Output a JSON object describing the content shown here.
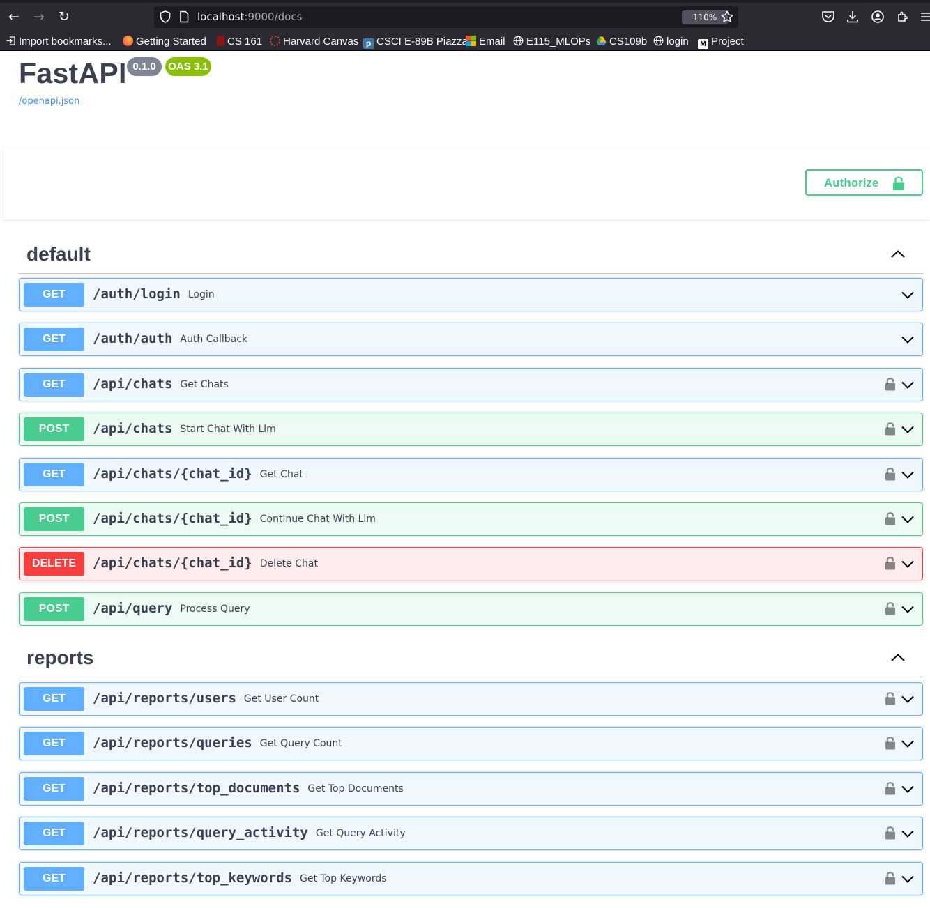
{
  "browser": {
    "url_host": "localhost",
    "url_path": ":9000/docs",
    "zoom": "110%",
    "bookmarks": [
      {
        "label": "Import bookmarks...",
        "icon": "import-icon"
      },
      {
        "label": "Getting Started",
        "icon": "firefox-icon"
      },
      {
        "label": "CS 161",
        "icon": "stanford-icon"
      },
      {
        "label": "Harvard Canvas",
        "icon": "canvas-icon"
      },
      {
        "label": "CSCI E-89B Piazza",
        "icon": "piazza-icon"
      },
      {
        "label": "Email",
        "icon": "microsoft-icon"
      },
      {
        "label": "E115_MLOPs",
        "icon": "globe-icon"
      },
      {
        "label": "CS109b",
        "icon": "drive-icon"
      },
      {
        "label": "login",
        "icon": "globe-icon"
      },
      {
        "label": "Project",
        "icon": "medium-icon"
      }
    ]
  },
  "info": {
    "title": "FastAPI",
    "version": "0.1.0",
    "oas": "OAS 3.1",
    "spec_link": "/openapi.json"
  },
  "auth": {
    "label": "Authorize"
  },
  "colors": {
    "get": "#61affe",
    "post": "#49cc90",
    "delete": "#f93e3e"
  },
  "tags": [
    {
      "name": "default",
      "operations": [
        {
          "method": "GET",
          "path": "/auth/login",
          "summary": "Login",
          "locked": false
        },
        {
          "method": "GET",
          "path": "/auth/auth",
          "summary": "Auth Callback",
          "locked": false
        },
        {
          "method": "GET",
          "path": "/api/chats",
          "summary": "Get Chats",
          "locked": true
        },
        {
          "method": "POST",
          "path": "/api/chats",
          "summary": "Start Chat With Llm",
          "locked": true
        },
        {
          "method": "GET",
          "path": "/api/chats/{chat_id}",
          "summary": "Get Chat",
          "locked": true
        },
        {
          "method": "POST",
          "path": "/api/chats/{chat_id}",
          "summary": "Continue Chat With Llm",
          "locked": true
        },
        {
          "method": "DELETE",
          "path": "/api/chats/{chat_id}",
          "summary": "Delete Chat",
          "locked": true
        },
        {
          "method": "POST",
          "path": "/api/query",
          "summary": "Process Query",
          "locked": true
        }
      ]
    },
    {
      "name": "reports",
      "operations": [
        {
          "method": "GET",
          "path": "/api/reports/users",
          "summary": "Get User Count",
          "locked": true
        },
        {
          "method": "GET",
          "path": "/api/reports/queries",
          "summary": "Get Query Count",
          "locked": true
        },
        {
          "method": "GET",
          "path": "/api/reports/top_documents",
          "summary": "Get Top Documents",
          "locked": true
        },
        {
          "method": "GET",
          "path": "/api/reports/query_activity",
          "summary": "Get Query Activity",
          "locked": true
        },
        {
          "method": "GET",
          "path": "/api/reports/top_keywords",
          "summary": "Get Top Keywords",
          "locked": true
        }
      ]
    }
  ]
}
